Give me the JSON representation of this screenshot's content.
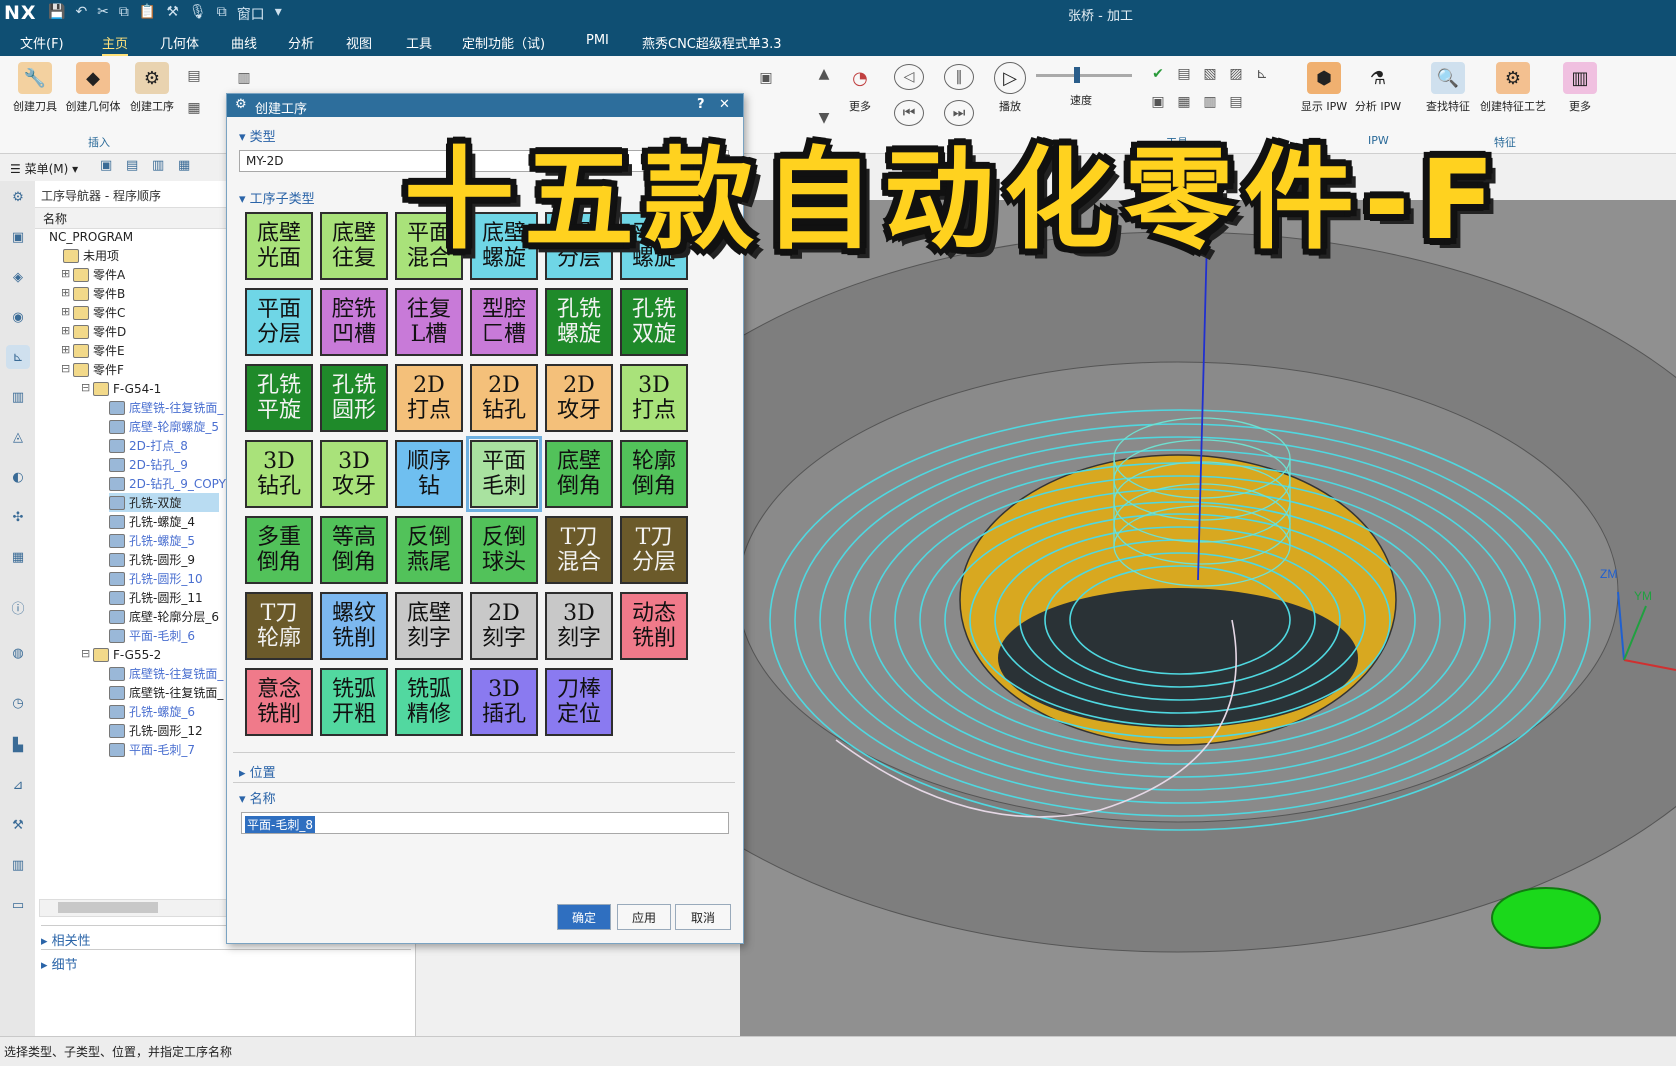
{
  "app": {
    "logo": "NX",
    "window_title": "张桥 - 加工"
  },
  "menu": [
    "文件(F)",
    "主页",
    "几何体",
    "曲线",
    "分析",
    "视图",
    "工具",
    "定制功能（试)",
    "PMI",
    "燕秀CNC超级程式单3.3"
  ],
  "quick_access": {
    "window_label": "窗口"
  },
  "ribbon": {
    "left_buttons": [
      "创建刀具",
      "创建几何体",
      "创建工序"
    ],
    "insert_group": "插入",
    "more": "更多",
    "play": "播放",
    "speed": "速度",
    "tool_group": "工具",
    "right_buttons": [
      "显示 IPW",
      "分析 IPW",
      "查找特征",
      "创建特征工艺",
      "更多"
    ],
    "feature_group": "特征",
    "ipw_group": "IPW"
  },
  "toolbar2": {
    "menu_label": "菜单(M)"
  },
  "navigator": {
    "title": "工序导航器 - 程序顺序",
    "column": "名称",
    "rows": [
      "NC_PROGRAM",
      "未用项",
      "零件A",
      "零件B",
      "零件C",
      "零件D",
      "零件E",
      "零件F",
      "F-G54-1",
      "底壁铣-往复铣面_",
      "底壁-轮廓螺旋_5",
      "2D-打点_8",
      "2D-钻孔_9",
      "2D-钻孔_9_COPY",
      "孔铣-双旋",
      "孔铣-螺旋_4",
      "孔铣-螺旋_5",
      "孔铣-圆形_9",
      "孔铣-圆形_10",
      "孔铣-圆形_11",
      "底壁-轮廓分层_6",
      "平面-毛刺_6",
      "F-G55-2",
      "底壁铣-往复铣面_",
      "底壁铣-往复铣面_",
      "孔铣-螺旋_6",
      "孔铣-圆形_12",
      "平面-毛刺_7"
    ],
    "related": "相关性",
    "details": "细节"
  },
  "dialog": {
    "title": "创建工序",
    "help": "?",
    "close": "✕",
    "type_section": "类型",
    "type_value": "MY-2D",
    "subtype_section": "工序子类型",
    "position_section": "位置",
    "name_section": "名称",
    "name_value": "平面-毛刺_8",
    "ok": "确定",
    "apply": "应用",
    "cancel": "取消",
    "tiles": [
      [
        "底壁",
        "光面"
      ],
      [
        "底壁",
        "往复"
      ],
      [
        "平面",
        "混合"
      ],
      [
        "底壁",
        "螺旋"
      ],
      [
        "底壁",
        "分层"
      ],
      [
        "平面",
        "螺旋"
      ],
      [
        "平面",
        "分层"
      ],
      [
        "腔铣",
        "凹槽"
      ],
      [
        "往复",
        "L槽"
      ],
      [
        "型腔",
        "匚槽"
      ],
      [
        "孔铣",
        "螺旋"
      ],
      [
        "孔铣",
        "双旋"
      ],
      [
        "孔铣",
        "平旋"
      ],
      [
        "孔铣",
        "圆形"
      ],
      [
        "2D",
        "打点"
      ],
      [
        "2D",
        "钻孔"
      ],
      [
        "2D",
        "攻牙"
      ],
      [
        "3D",
        "打点"
      ],
      [
        "3D",
        "钻孔"
      ],
      [
        "3D",
        "攻牙"
      ],
      [
        "顺序",
        "钻"
      ],
      [
        "平面",
        "毛刺"
      ],
      [
        "底壁",
        "倒角"
      ],
      [
        "轮廓",
        "倒角"
      ],
      [
        "多重",
        "倒角"
      ],
      [
        "等高",
        "倒角"
      ],
      [
        "反倒",
        "燕尾"
      ],
      [
        "反倒",
        "球头"
      ],
      [
        "T刀",
        "混合"
      ],
      [
        "T刀",
        "分层"
      ],
      [
        "T刀",
        "轮廓"
      ],
      [
        "螺纹",
        "铣削"
      ],
      [
        "底壁",
        "刻字"
      ],
      [
        "2D",
        "刻字"
      ],
      [
        "3D",
        "刻字"
      ],
      [
        "动态",
        "铣削"
      ],
      [
        "意念",
        "铣削"
      ],
      [
        "铣弧",
        "开粗"
      ],
      [
        "铣弧",
        "精修"
      ],
      [
        "3D",
        "插孔"
      ],
      [
        "刀棒",
        "定位"
      ]
    ],
    "tile_colors": [
      "#a9e27a",
      "#a9e27a",
      "#a9e27a",
      "#6fd6e6",
      "#6fd6e6",
      "#6fd6e6",
      "#6fd6e6",
      "#c87ad8",
      "#c87ad8",
      "#c87ad8",
      "#1f8a2a",
      "#1f8a2a",
      "#1f8a2a",
      "#1f8a2a",
      "#f4c07a",
      "#f4c07a",
      "#f4c07a",
      "#a9e27a",
      "#a9e27a",
      "#a9e27a",
      "#6fbff0",
      "#a9e2a0",
      "#52c25a",
      "#52c25a",
      "#52c25a",
      "#52c25a",
      "#52c25a",
      "#52c25a",
      "#6b5a2a",
      "#6b5a2a",
      "#6b5a2a",
      "#7cb8f0",
      "#c8c8c8",
      "#c8c8c8",
      "#c8c8c8",
      "#f07a8a",
      "#f07a8a",
      "#52d8a0",
      "#52d8a0",
      "#8a7af0",
      "#8a7af0"
    ]
  },
  "overlay_text": "十五款自动化零件-F",
  "viewport_axes": {
    "zm": "ZM",
    "ym": "YM"
  },
  "status": "选择类型、子类型、位置，并指定工序名称"
}
